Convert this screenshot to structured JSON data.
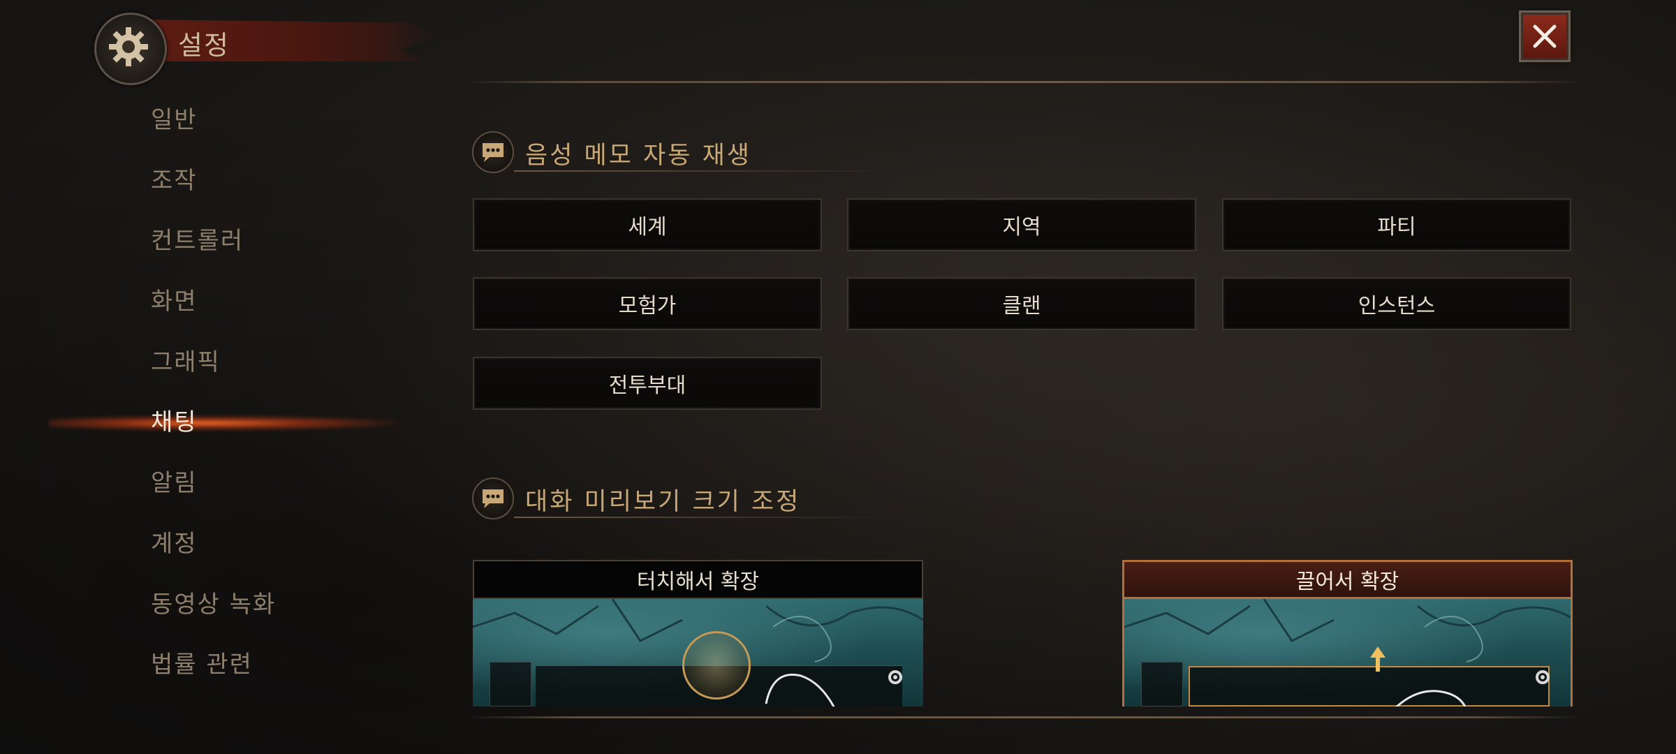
{
  "header": {
    "title": "설정",
    "close_icon": "close-icon",
    "settings_icon": "gear-icon"
  },
  "sidebar": {
    "active_index": 5,
    "items": [
      {
        "label": "일반"
      },
      {
        "label": "조작"
      },
      {
        "label": "컨트롤러"
      },
      {
        "label": "화면"
      },
      {
        "label": "그래픽"
      },
      {
        "label": "채팅"
      },
      {
        "label": "알림"
      },
      {
        "label": "계정"
      },
      {
        "label": "동영상 녹화"
      },
      {
        "label": "법률 관련"
      }
    ]
  },
  "voice_memo": {
    "title": "음성 메모 자동 재생",
    "icon": "chat-bubble-icon",
    "options": [
      "세계",
      "지역",
      "파티",
      "모험가",
      "클랜",
      "인스턴스",
      "전투부대"
    ]
  },
  "preview_size": {
    "title": "대화 미리보기 크기 조정",
    "icon": "chat-bubble-icon",
    "options": [
      {
        "label": "터치해서 확장",
        "selected": false
      },
      {
        "label": "끌어서 확장",
        "selected": true
      }
    ]
  },
  "colors": {
    "accent": "#c9a877",
    "selected_border": "#b4703c",
    "close_bg": "#8a2a1c"
  }
}
